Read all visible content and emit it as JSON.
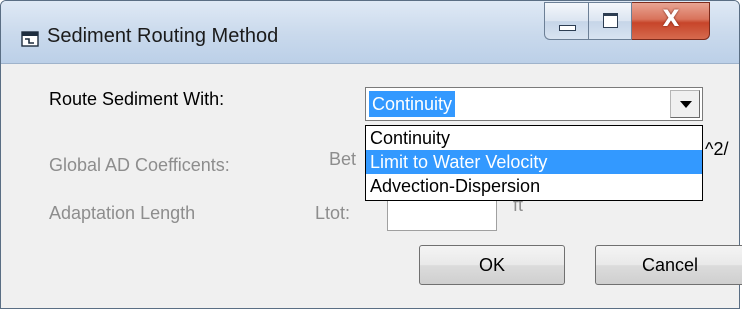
{
  "window": {
    "title": "Sediment Routing Method",
    "icon": "window-app-icon",
    "controls": {
      "minimize": "minimize-icon",
      "maximize": "maximize-icon",
      "close": "close-icon",
      "close_glyph": "X"
    }
  },
  "form": {
    "route_label": "Route Sediment With:",
    "route_selected": "Continuity",
    "route_options": [
      "Continuity",
      "Limit to Water Velocity",
      "Advection-Dispersion"
    ],
    "route_highlighted": "Limit to Water Velocity",
    "ad_label": "Global AD Coefficents:",
    "ad_prefix": "Bet",
    "ad_suffix": "^2/",
    "adapt_label": "Adaptation Length",
    "adapt_prefix": "Ltot:",
    "adapt_value": "",
    "adapt_unit": "ft"
  },
  "buttons": {
    "ok": "OK",
    "cancel": "Cancel"
  },
  "colors": {
    "selection": "#3399ff",
    "disabled_text": "#8d8d8d",
    "titlebar": "#c9d9ec",
    "close_button": "#c7452a"
  }
}
